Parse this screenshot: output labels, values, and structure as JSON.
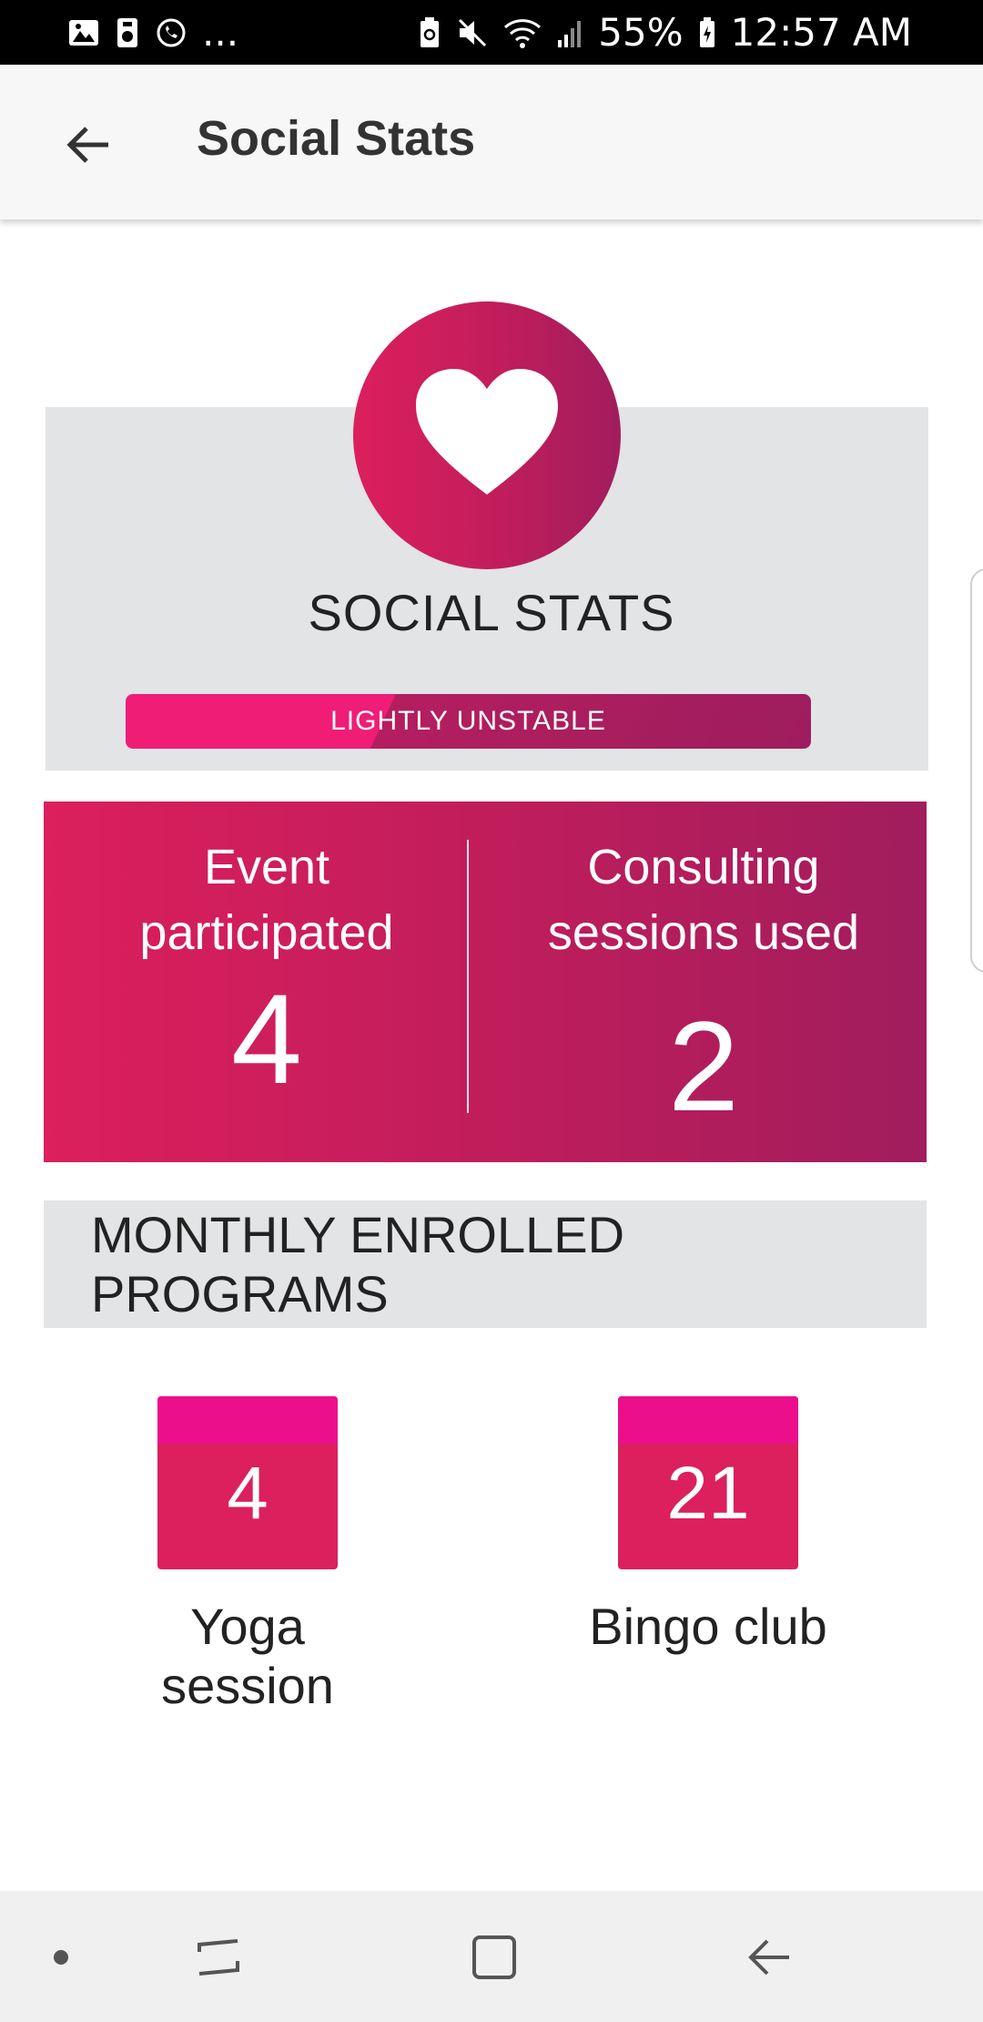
{
  "status_bar": {
    "overflow": "...",
    "battery": "55%",
    "time": "12:57 AM",
    "icons": [
      "image-icon",
      "storage-icon",
      "whatsapp-icon",
      "battery-saver-icon",
      "mute-icon",
      "wifi-icon",
      "signal-icon",
      "battery-icon"
    ]
  },
  "app_bar": {
    "title": "Social Stats",
    "back_icon": "arrow-back-icon"
  },
  "social_stats": {
    "icon": "heart-icon",
    "title": "SOCIAL STATS",
    "status": "LIGHTLY UNSTABLE"
  },
  "counters": [
    {
      "label": "Event participated",
      "value": "4"
    },
    {
      "label": "Consulting sessions used",
      "value": "2"
    }
  ],
  "programs": {
    "header": "MONTHLY ENROLLED PROGRAMS",
    "items": [
      {
        "count": "4",
        "label": "Yoga session"
      },
      {
        "count": "21",
        "label": "Bingo club"
      }
    ]
  },
  "nav_bar": {
    "icons": [
      "dot-icon",
      "recent-apps-icon",
      "home-icon",
      "back-icon"
    ]
  },
  "colors": {
    "accent_start": "#dc1f5d",
    "accent_end": "#a11d5d",
    "calendar_top": "#ec0f8c",
    "card_gray": "#e3e4e6"
  }
}
